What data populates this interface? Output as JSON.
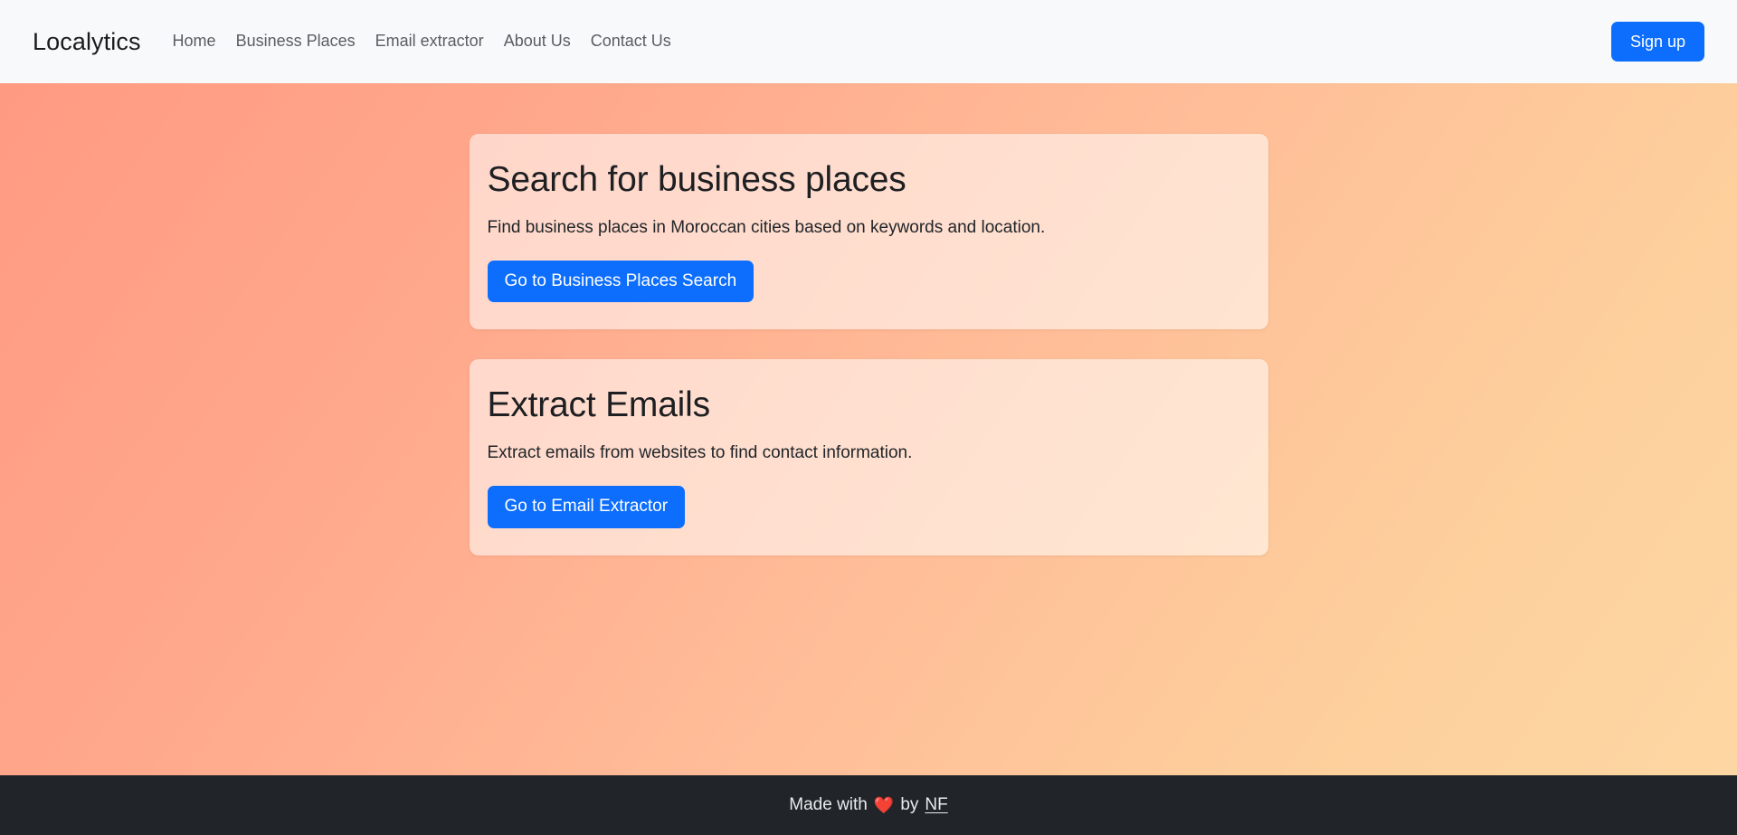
{
  "navbar": {
    "brand": "Localytics",
    "links": [
      {
        "label": "Home"
      },
      {
        "label": "Business Places"
      },
      {
        "label": "Email extractor"
      },
      {
        "label": "About Us"
      },
      {
        "label": "Contact Us"
      }
    ],
    "signup_label": "Sign up",
    "background_color": "#f8f9fa",
    "accent_color": "#0d6efd"
  },
  "hero": {
    "gradient_from": "#ff9a82",
    "gradient_to": "#fdd7a3",
    "cards": [
      {
        "title": "Search for business places",
        "text": "Find business places in Moroccan cities based on keywords and location.",
        "cta_label": "Go to Business Places Search"
      },
      {
        "title": "Extract Emails",
        "text": "Extract emails from websites to find contact information.",
        "cta_label": "Go to Email Extractor"
      }
    ]
  },
  "footer": {
    "made_with": "Made with",
    "heart": "❤️",
    "by": "by",
    "author": "NF",
    "background_color": "#212529"
  }
}
